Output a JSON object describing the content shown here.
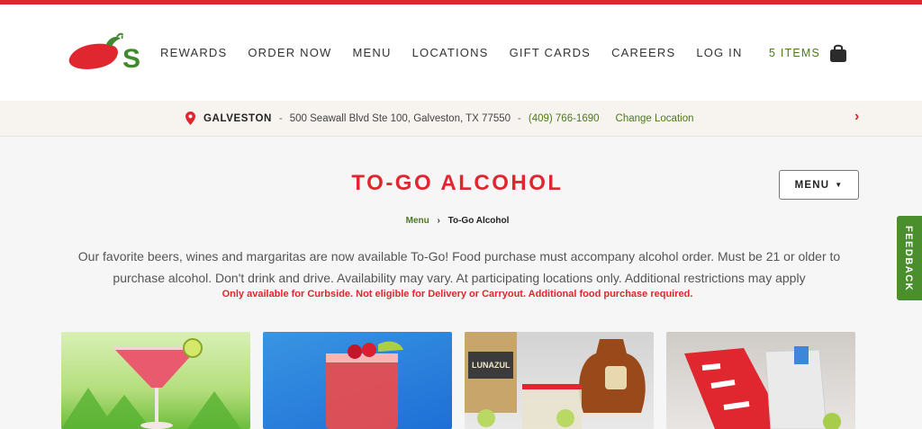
{
  "brand": {
    "accent": "#e0262e",
    "green": "#4a7a1e"
  },
  "nav": {
    "items": [
      "REWARDS",
      "ORDER NOW",
      "MENU",
      "LOCATIONS",
      "GIFT CARDS",
      "CAREERS",
      "LOG IN"
    ],
    "cart_label": "5 ITEMS"
  },
  "location": {
    "city": "GALVESTON",
    "sep1": "-",
    "address": "500 Seawall Blvd Ste 100, Galveston, TX 77550",
    "sep2": "-",
    "phone": "(409) 766-1690",
    "change_label": "Change Location",
    "next_glyph": "›"
  },
  "page": {
    "title": "TO-GO ALCOHOL",
    "menu_button": "MENU",
    "breadcrumb": {
      "parent": "Menu",
      "separator": "›",
      "current": "To-Go Alcohol"
    },
    "description": "Our favorite beers, wines and margaritas are now available To-Go! Food purchase must accompany alcohol order. Must be 21 or older to purchase alcohol. Don't drink and drive. Availability may vary. At participating locations only. Additional restrictions may apply",
    "notice": "Only available for Curbside. Not eligible for Delivery or Carryout. Additional food purchase required."
  },
  "feedback_label": "FEEDBACK",
  "icons": [
    "chilis-logo",
    "shopping-bag-icon",
    "location-pin-icon",
    "chevron-right-icon",
    "caret-down-icon"
  ]
}
